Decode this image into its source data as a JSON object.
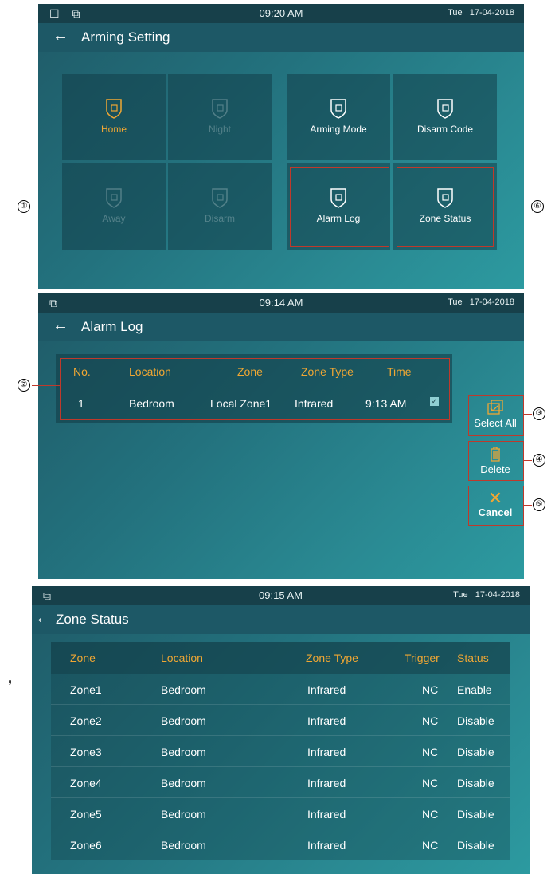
{
  "screen1": {
    "status": {
      "icons": "☐ ⧉",
      "time": "09:20 AM",
      "day": "Tue",
      "date": "17-04-2018"
    },
    "title": "Arming Setting",
    "tiles": [
      {
        "label": "Home",
        "icon": "shield-home-icon",
        "state": "active"
      },
      {
        "label": "Night",
        "icon": "shield-night-icon",
        "state": "disabled"
      },
      {
        "label": "Arming Mode",
        "icon": "shield-grid-icon",
        "state": "normal"
      },
      {
        "label": "Disarm Code",
        "icon": "shield-code-icon",
        "state": "normal"
      },
      {
        "label": "Away",
        "icon": "shield-away-icon",
        "state": "disabled"
      },
      {
        "label": "Disarm",
        "icon": "shield-x-icon",
        "state": "disabled"
      },
      {
        "label": "Alarm Log",
        "icon": "shield-log-icon",
        "state": "normal"
      },
      {
        "label": "Zone Status",
        "icon": "shield-zone-icon",
        "state": "normal"
      }
    ],
    "callouts": [
      "①",
      "⑥"
    ]
  },
  "screen2": {
    "status": {
      "time": "09:14 AM",
      "day": "Tue",
      "date": "17-04-2018"
    },
    "title": "Alarm Log",
    "columns": [
      "No.",
      "Location",
      "Zone",
      "Zone Type",
      "Time"
    ],
    "rows": [
      [
        "1",
        "Bedroom",
        "Local Zone1",
        "Infrared",
        "9:13 AM"
      ]
    ],
    "buttons": {
      "select_all": "Select All",
      "delete": "Delete",
      "cancel": "Cancel"
    },
    "callouts": [
      "②",
      "③",
      "④",
      "⑤"
    ]
  },
  "screen3": {
    "status": {
      "time": "09:15 AM",
      "day": "Tue",
      "date": "17-04-2018"
    },
    "title": "Zone Status",
    "columns": [
      "Zone",
      "Location",
      "Zone Type",
      "Trigger",
      "Status"
    ],
    "rows": [
      [
        "Zone1",
        "Bedroom",
        "Infrared",
        "NC",
        "Enable"
      ],
      [
        "Zone2",
        "Bedroom",
        "Infrared",
        "NC",
        "Disable"
      ],
      [
        "Zone3",
        "Bedroom",
        "Infrared",
        "NC",
        "Disable"
      ],
      [
        "Zone4",
        "Bedroom",
        "Infrared",
        "NC",
        "Disable"
      ],
      [
        "Zone5",
        "Bedroom",
        "Infrared",
        "NC",
        "Disable"
      ],
      [
        "Zone6",
        "Bedroom",
        "Infrared",
        "NC",
        "Disable"
      ]
    ]
  },
  "stray_mark": ",",
  "colors": {
    "accent": "#f0a733",
    "callout": "#c0392b",
    "statusbar": "#17404a",
    "titlebar": "#1d5866"
  }
}
